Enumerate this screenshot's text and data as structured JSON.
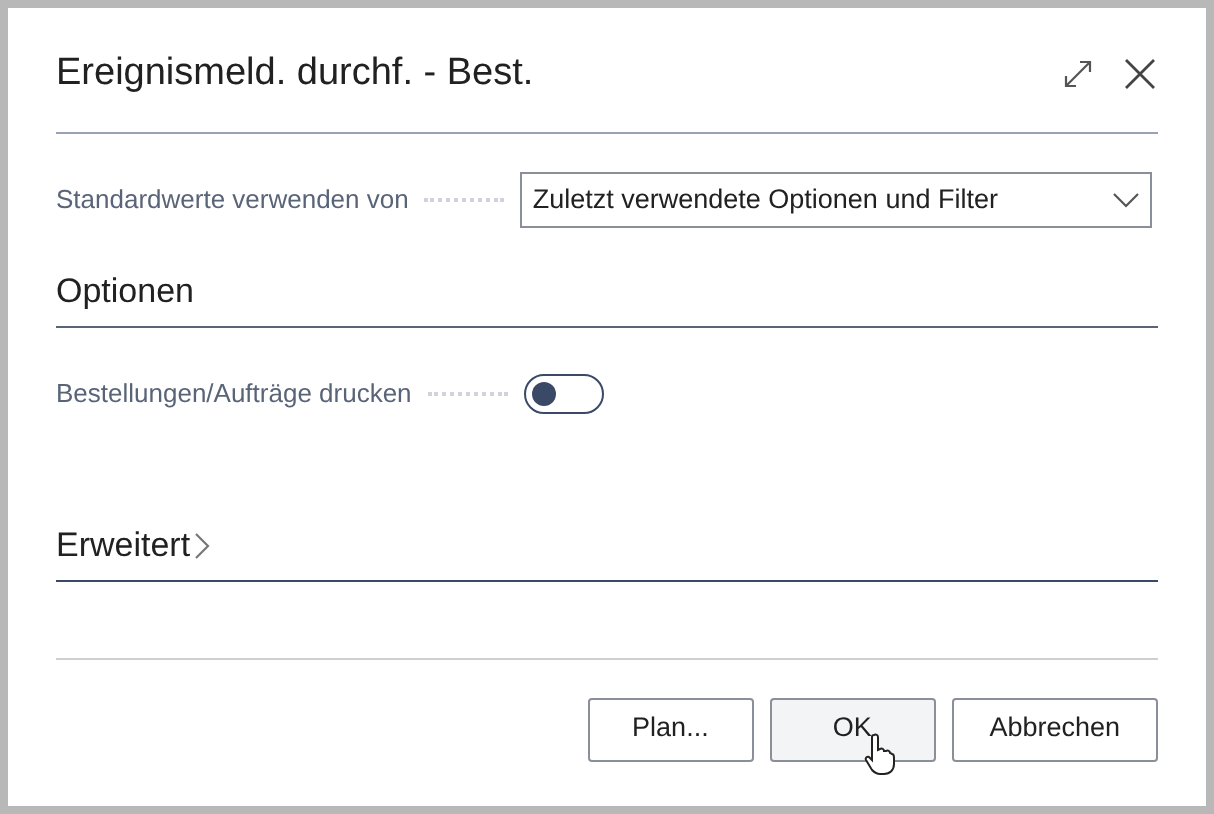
{
  "dialog": {
    "title": "Ereignismeld. durchf. - Best."
  },
  "defaults_field": {
    "label": "Standardwerte verwenden von",
    "value": "Zuletzt verwendete Optionen und Filter"
  },
  "options_section": {
    "title": "Optionen",
    "fields": [
      {
        "label": "Bestellungen/Aufträge drucken",
        "on": false
      }
    ]
  },
  "advanced_section": {
    "title": "Erweitert",
    "expanded": false
  },
  "buttons": [
    {
      "label": "Plan...",
      "hovered": false
    },
    {
      "label": "OK",
      "hovered": true
    },
    {
      "label": "Abbrechen",
      "hovered": false
    }
  ]
}
